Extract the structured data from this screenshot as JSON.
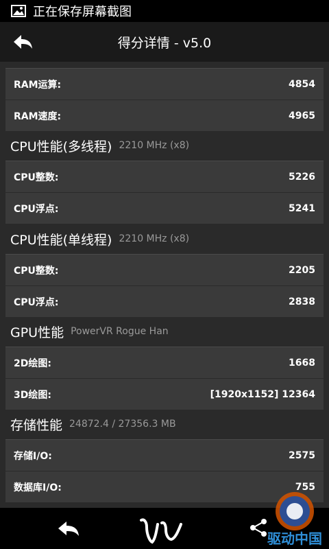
{
  "status_bar": {
    "text": "正在保存屏幕截图",
    "icon": "image-icon"
  },
  "header": {
    "title": "得分详情 - v5.0",
    "back_icon": "back-arrow-icon"
  },
  "cards": {
    "ram": [
      {
        "label": "RAM运算:",
        "value": "4854"
      },
      {
        "label": "RAM速度:",
        "value": "4965"
      }
    ],
    "cpu_multi": [
      {
        "label": "CPU整数:",
        "value": "5226"
      },
      {
        "label": "CPU浮点:",
        "value": "5241"
      }
    ],
    "cpu_single": [
      {
        "label": "CPU整数:",
        "value": "2205"
      },
      {
        "label": "CPU浮点:",
        "value": "2838"
      }
    ],
    "gpu": [
      {
        "label": "2D绘图:",
        "value": "1668"
      },
      {
        "label": "3D绘图:",
        "value": "[1920x1152] 12364"
      }
    ],
    "storage": [
      {
        "label": "存储I/O:",
        "value": "2575"
      },
      {
        "label": "数据库I/O:",
        "value": "755"
      }
    ]
  },
  "sections": {
    "cpu_multi": {
      "title": "CPU性能(多线程)",
      "subtitle": "2210 MHz (x8)"
    },
    "cpu_single": {
      "title": "CPU性能(单线程)",
      "subtitle": "2210 MHz (x8)"
    },
    "gpu": {
      "title": "GPU性能",
      "subtitle": "PowerVR Rogue Han"
    },
    "storage": {
      "title": "存储性能",
      "subtitle": "24872.4 / 27356.3 MB"
    }
  },
  "bottom_bar": {
    "icons": [
      "back-arrow-icon",
      "antutu-logo-icon",
      "share-icon"
    ]
  },
  "watermark": {
    "text": "驱动中国"
  },
  "colors": {
    "background": "#2a2a2a",
    "card": "#3a3a3a",
    "header": "#1a1a1a",
    "subtitle": "#9a9a9a"
  }
}
